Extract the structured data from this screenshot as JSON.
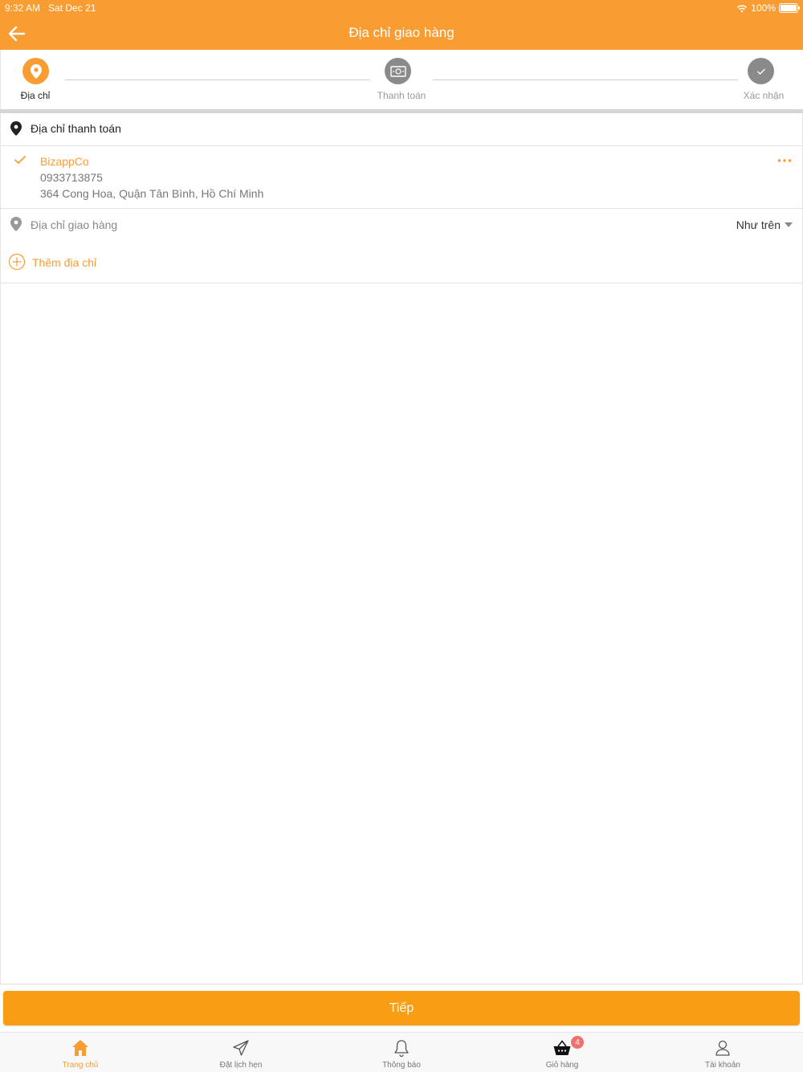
{
  "status_bar": {
    "time": "9:32 AM",
    "date": "Sat Dec 21",
    "battery": "100%"
  },
  "header": {
    "title": "Địa chỉ giao hàng",
    "back_icon": "arrow-left-icon"
  },
  "steps": [
    {
      "label": "Địa chỉ",
      "icon": "location-pin-icon",
      "active": true
    },
    {
      "label": "Thanh toán",
      "icon": "cash-icon",
      "active": false
    },
    {
      "label": "Xác nhận",
      "icon": "check-icon",
      "active": false
    }
  ],
  "billing": {
    "heading": "Địa chỉ thanh toán",
    "address": {
      "name": "BizappCo",
      "phone": "0933713875",
      "street": "364 Cong Hoa, Quận Tân Bình, Hồ Chí Minh"
    }
  },
  "shipping": {
    "heading": "Địa chỉ giao hàng",
    "selected_option": "Như trên",
    "add_label": "Thêm địa chỉ"
  },
  "actions": {
    "next_label": "Tiếp"
  },
  "tabbar": [
    {
      "label": "Trang chủ",
      "icon": "home-icon",
      "active": true
    },
    {
      "label": "Đặt lịch hẹn",
      "icon": "paper-plane-icon",
      "active": false
    },
    {
      "label": "Thông báo",
      "icon": "bell-icon",
      "active": false
    },
    {
      "label": "Giỏ hàng",
      "icon": "basket-icon",
      "active": false,
      "badge": "4"
    },
    {
      "label": "Tài khoản",
      "icon": "user-icon",
      "active": false
    }
  ],
  "colors": {
    "accent": "#f99d33",
    "button": "#f99d14",
    "inactive_step": "#8a8a8a",
    "badge": "#f07070"
  }
}
